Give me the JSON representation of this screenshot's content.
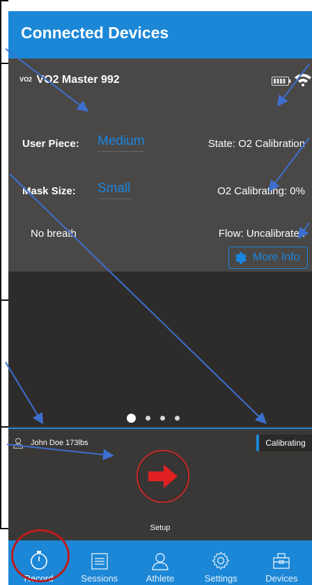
{
  "header": {
    "title": "Connected Devices"
  },
  "device": {
    "brand_mark": "VO2",
    "name": "VO2 Master 992"
  },
  "fields": {
    "user_piece_label": "User Piece:",
    "user_piece_value": "Medium",
    "mask_size_label": "Mask Size:",
    "mask_size_value": "Small",
    "breath_status": "No breath"
  },
  "status": {
    "state": "State: O2 Calibration",
    "o2": "O2 Calibrating: 0%",
    "flow": "Flow: Uncalibrated"
  },
  "more_info_label": "More Info",
  "pager": {
    "count": 4,
    "active": 0
  },
  "athlete": {
    "name": "John Doe 173lbs"
  },
  "badge": {
    "label": "Calibrating"
  },
  "setup": {
    "label": "Setup"
  },
  "tabs": [
    {
      "label": "Record",
      "icon": "stopwatch-icon"
    },
    {
      "label": "Sessions",
      "icon": "list-icon"
    },
    {
      "label": "Athlete",
      "icon": "person-icon"
    },
    {
      "label": "Settings",
      "icon": "gear-icon"
    },
    {
      "label": "Devices",
      "icon": "device-case-icon"
    }
  ],
  "colors": {
    "brand_blue": "#1c87d6",
    "accent_blue": "#1a86e0",
    "highlight_red": "#c42a2a"
  }
}
